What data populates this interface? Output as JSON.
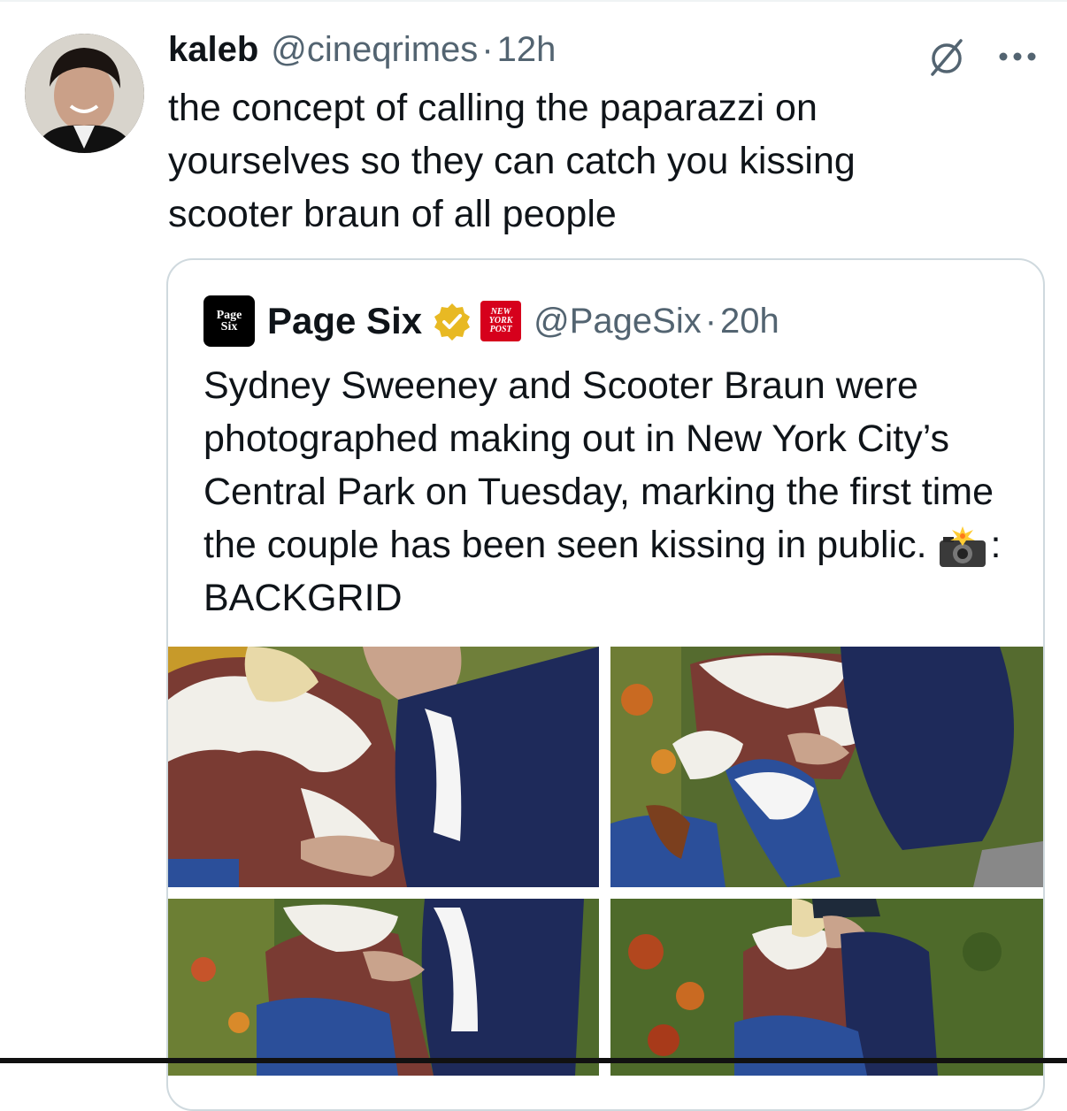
{
  "tweet": {
    "author_name": "kaleb",
    "author_handle": "@cineqrimes",
    "separator": "·",
    "time": "12h",
    "text": "the concept of calling the paparazzi on\nyourselves so they can catch you kissing\nscooter braun of all people"
  },
  "icons": {
    "grok": "grok-icon",
    "more": "more-icon",
    "verified": "verified-badge-icon",
    "affiliate": "new-york-post-affiliate-icon",
    "camera": "camera-flash-emoji"
  },
  "quote": {
    "logo_line1": "Page",
    "logo_line2": "Six",
    "author_name": "Page Six",
    "affiliate_line1": "NEW",
    "affiliate_line2": "YORK",
    "affiliate_line3": "POST",
    "author_handle": "@PageSix",
    "separator": "·",
    "time": "20h",
    "text_main": "Sydney Sweeney and Scooter Braun were photographed making out in New York City’s Central Park on Tuesday, marking the first time the couple has been seen kissing in public.",
    "text_credit": ": BACKGRID"
  },
  "colors": {
    "text": "#0f1419",
    "secondary": "#536471",
    "border": "#cfd9de",
    "verified_gold": "#e8b923",
    "nyp_red": "#d6001c"
  }
}
